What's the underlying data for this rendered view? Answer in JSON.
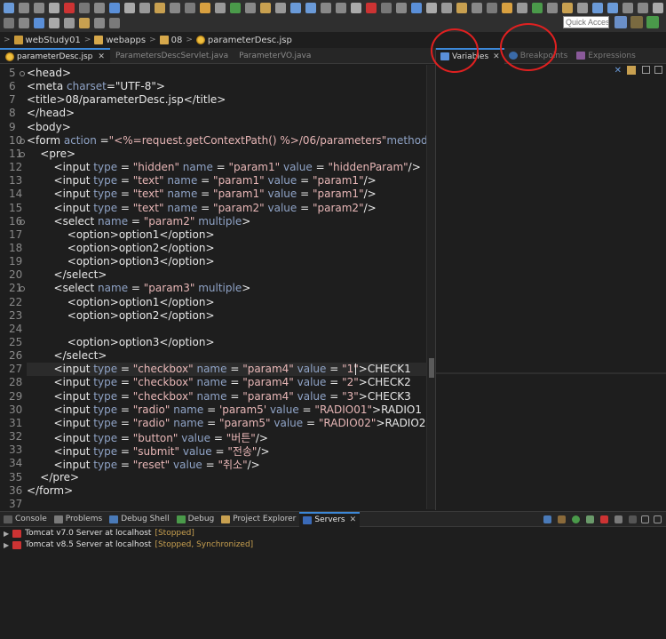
{
  "toolbar": {
    "quick_access_placeholder": "Quick Access"
  },
  "breadcrumb": [
    {
      "label": "webStudy01",
      "icon": "project-icon"
    },
    {
      "label": "webapps",
      "icon": "folder-icon"
    },
    {
      "label": "08",
      "icon": "folder-icon"
    },
    {
      "label": "parameterDesc.jsp",
      "icon": "jsp-file-icon"
    }
  ],
  "editor_tabs": [
    {
      "label": "parameterDesc.jsp",
      "active": true
    },
    {
      "label": "ParametersDescServlet.java",
      "active": false
    },
    {
      "label": "ParameterVO.java",
      "active": false
    }
  ],
  "right_tabs": [
    {
      "label": "Variables",
      "active": true
    },
    {
      "label": "Breakpoints",
      "active": false
    },
    {
      "label": "Expressions",
      "active": false
    }
  ],
  "code": {
    "highlight_line": 27,
    "lines": [
      {
        "n": "5",
        "fold": true,
        "tokens": [
          [
            "tag",
            "<head>"
          ]
        ]
      },
      {
        "n": "6",
        "fold": false,
        "tokens": [
          [
            "tag",
            "<meta "
          ],
          [
            "at",
            "charset"
          ],
          [
            "tag",
            "=\"UTF-8\">"
          ]
        ]
      },
      {
        "n": "7",
        "fold": false,
        "tokens": [
          [
            "tag",
            "<title>08/parameterDesc.jsp</title>"
          ]
        ]
      },
      {
        "n": "8",
        "fold": false,
        "tokens": [
          [
            "tag",
            "</head>"
          ]
        ]
      },
      {
        "n": "9",
        "fold": false,
        "tokens": [
          [
            "tag",
            "<body>"
          ]
        ]
      },
      {
        "n": "10",
        "fold": true,
        "tokens": [
          [
            "tag",
            "<form "
          ],
          [
            "at",
            "action"
          ],
          [
            "tag",
            " ="
          ],
          [
            "str",
            "\"<%=request.getContextPath() %>/06/parameters\""
          ],
          [
            "at",
            "method"
          ],
          [
            "tag",
            " = "
          ],
          [
            "str",
            "\"ge"
          ]
        ]
      },
      {
        "n": "11",
        "fold": true,
        "tokens": [
          [
            "tag",
            "    <pre>"
          ]
        ]
      },
      {
        "n": "12",
        "fold": false,
        "tokens": [
          [
            "tag",
            "        <input "
          ],
          [
            "at",
            "type"
          ],
          [
            "tag",
            " = "
          ],
          [
            "str",
            "\"hidden\""
          ],
          [
            "tag",
            " "
          ],
          [
            "at",
            "name"
          ],
          [
            "tag",
            " = "
          ],
          [
            "str",
            "\"param1\""
          ],
          [
            "tag",
            " "
          ],
          [
            "at",
            "value"
          ],
          [
            "tag",
            " = "
          ],
          [
            "str",
            "\"hiddenParam\""
          ],
          [
            "tag",
            "/>"
          ]
        ]
      },
      {
        "n": "13",
        "fold": false,
        "tokens": [
          [
            "tag",
            "        <input "
          ],
          [
            "at",
            "type"
          ],
          [
            "tag",
            " = "
          ],
          [
            "str",
            "\"text\""
          ],
          [
            "tag",
            " "
          ],
          [
            "at",
            "name"
          ],
          [
            "tag",
            " = "
          ],
          [
            "str",
            "\"param1\""
          ],
          [
            "tag",
            " "
          ],
          [
            "at",
            "value"
          ],
          [
            "tag",
            " = "
          ],
          [
            "str",
            "\"param1\""
          ],
          [
            "tag",
            "/>"
          ]
        ]
      },
      {
        "n": "14",
        "fold": false,
        "tokens": [
          [
            "tag",
            "        <input "
          ],
          [
            "at",
            "type"
          ],
          [
            "tag",
            " = "
          ],
          [
            "str",
            "\"text\""
          ],
          [
            "tag",
            " "
          ],
          [
            "at",
            "name"
          ],
          [
            "tag",
            " = "
          ],
          [
            "str",
            "\"param1\""
          ],
          [
            "tag",
            " "
          ],
          [
            "at",
            "value"
          ],
          [
            "tag",
            " = "
          ],
          [
            "str",
            "\"param1\""
          ],
          [
            "tag",
            "/>"
          ]
        ]
      },
      {
        "n": "15",
        "fold": false,
        "tokens": [
          [
            "tag",
            "        <input "
          ],
          [
            "at",
            "type"
          ],
          [
            "tag",
            " = "
          ],
          [
            "str",
            "\"text\""
          ],
          [
            "tag",
            " "
          ],
          [
            "at",
            "name"
          ],
          [
            "tag",
            " = "
          ],
          [
            "str",
            "\"param2\""
          ],
          [
            "tag",
            " "
          ],
          [
            "at",
            "value"
          ],
          [
            "tag",
            " = "
          ],
          [
            "str",
            "\"param2\""
          ],
          [
            "tag",
            "/>"
          ]
        ]
      },
      {
        "n": "16",
        "fold": true,
        "tokens": [
          [
            "tag",
            "        <select "
          ],
          [
            "at",
            "name"
          ],
          [
            "tag",
            " = "
          ],
          [
            "str",
            "\"param2\""
          ],
          [
            "tag",
            " "
          ],
          [
            "at",
            "multiple"
          ],
          [
            "tag",
            ">"
          ]
        ]
      },
      {
        "n": "17",
        "fold": false,
        "tokens": [
          [
            "tag",
            "            <option>option1</option>"
          ]
        ]
      },
      {
        "n": "18",
        "fold": false,
        "tokens": [
          [
            "tag",
            "            <option>option2</option>"
          ]
        ]
      },
      {
        "n": "19",
        "fold": false,
        "tokens": [
          [
            "tag",
            "            <option>option3</option>"
          ]
        ]
      },
      {
        "n": "20",
        "fold": false,
        "tokens": [
          [
            "tag",
            "        </select>"
          ]
        ]
      },
      {
        "n": "21",
        "fold": true,
        "tokens": [
          [
            "tag",
            "        <select "
          ],
          [
            "at",
            "name"
          ],
          [
            "tag",
            " = "
          ],
          [
            "str",
            "\"param3\""
          ],
          [
            "tag",
            " "
          ],
          [
            "at",
            "multiple"
          ],
          [
            "tag",
            ">"
          ]
        ]
      },
      {
        "n": "22",
        "fold": false,
        "tokens": [
          [
            "tag",
            "            <option>option1</option>"
          ]
        ]
      },
      {
        "n": "23",
        "fold": false,
        "tokens": [
          [
            "tag",
            "            <option>option2</option>"
          ]
        ]
      },
      {
        "n": "24",
        "fold": false,
        "tokens": []
      },
      {
        "n": "25",
        "fold": false,
        "tokens": [
          [
            "tag",
            "            <option>option3</option>"
          ]
        ]
      },
      {
        "n": "26",
        "fold": false,
        "tokens": [
          [
            "tag",
            "        </select>"
          ]
        ]
      },
      {
        "n": "27",
        "fold": false,
        "tokens": [
          [
            "tag",
            "        <input "
          ],
          [
            "at",
            "type"
          ],
          [
            "tag",
            " = "
          ],
          [
            "str",
            "\"checkbox\""
          ],
          [
            "tag",
            " "
          ],
          [
            "at",
            "name"
          ],
          [
            "tag",
            " = "
          ],
          [
            "str",
            "\"param4\""
          ],
          [
            "tag",
            " "
          ],
          [
            "at",
            "value"
          ],
          [
            "tag",
            " = "
          ],
          [
            "str",
            "\"1\""
          ],
          [
            "tag",
            ">CHECK1"
          ]
        ]
      },
      {
        "n": "28",
        "fold": false,
        "tokens": [
          [
            "tag",
            "        <input "
          ],
          [
            "at",
            "type"
          ],
          [
            "tag",
            " = "
          ],
          [
            "str",
            "\"checkbox\""
          ],
          [
            "tag",
            " "
          ],
          [
            "at",
            "name"
          ],
          [
            "tag",
            " = "
          ],
          [
            "str",
            "\"param4\""
          ],
          [
            "tag",
            " "
          ],
          [
            "at",
            "value"
          ],
          [
            "tag",
            " = "
          ],
          [
            "str",
            "\"2\""
          ],
          [
            "tag",
            ">CHECK2"
          ]
        ]
      },
      {
        "n": "29",
        "fold": false,
        "tokens": [
          [
            "tag",
            "        <input "
          ],
          [
            "at",
            "type"
          ],
          [
            "tag",
            " = "
          ],
          [
            "str",
            "\"checkbox\""
          ],
          [
            "tag",
            " "
          ],
          [
            "at",
            "name"
          ],
          [
            "tag",
            " = "
          ],
          [
            "str",
            "\"param4\""
          ],
          [
            "tag",
            " "
          ],
          [
            "at",
            "value"
          ],
          [
            "tag",
            " = "
          ],
          [
            "str",
            "\"3\""
          ],
          [
            "tag",
            ">CHECK3"
          ]
        ]
      },
      {
        "n": "30",
        "fold": false,
        "tokens": [
          [
            "tag",
            "        <input "
          ],
          [
            "at",
            "type"
          ],
          [
            "tag",
            " = "
          ],
          [
            "str",
            "\"radio\""
          ],
          [
            "tag",
            " "
          ],
          [
            "at",
            "name"
          ],
          [
            "tag",
            " = "
          ],
          [
            "str",
            "'param5'"
          ],
          [
            "tag",
            " "
          ],
          [
            "at",
            "value"
          ],
          [
            "tag",
            " = "
          ],
          [
            "str",
            "\"RADIO01\""
          ],
          [
            "tag",
            ">RADIO1"
          ]
        ]
      },
      {
        "n": "31",
        "fold": false,
        "tokens": [
          [
            "tag",
            "        <input "
          ],
          [
            "at",
            "type"
          ],
          [
            "tag",
            " = "
          ],
          [
            "str",
            "\"radio\""
          ],
          [
            "tag",
            " "
          ],
          [
            "at",
            "name"
          ],
          [
            "tag",
            " = "
          ],
          [
            "str",
            "\"param5\""
          ],
          [
            "tag",
            " "
          ],
          [
            "at",
            "value"
          ],
          [
            "tag",
            " = "
          ],
          [
            "str",
            "\"RADIO02\""
          ],
          [
            "tag",
            ">RADIO2"
          ]
        ]
      },
      {
        "n": "32",
        "fold": false,
        "tokens": [
          [
            "tag",
            "        <input "
          ],
          [
            "at",
            "type"
          ],
          [
            "tag",
            " = "
          ],
          [
            "str",
            "\"button\""
          ],
          [
            "tag",
            " "
          ],
          [
            "at",
            "value"
          ],
          [
            "tag",
            " = "
          ],
          [
            "str",
            "\"버튼\""
          ],
          [
            "tag",
            "/>"
          ]
        ]
      },
      {
        "n": "33",
        "fold": false,
        "tokens": [
          [
            "tag",
            "        <input "
          ],
          [
            "at",
            "type"
          ],
          [
            "tag",
            " = "
          ],
          [
            "str",
            "\"submit\""
          ],
          [
            "tag",
            " "
          ],
          [
            "at",
            "value"
          ],
          [
            "tag",
            " = "
          ],
          [
            "str",
            "\"전송\""
          ],
          [
            "tag",
            "/>"
          ]
        ]
      },
      {
        "n": "34",
        "fold": false,
        "tokens": [
          [
            "tag",
            "        <input "
          ],
          [
            "at",
            "type"
          ],
          [
            "tag",
            " = "
          ],
          [
            "str",
            "\"reset\""
          ],
          [
            "tag",
            " "
          ],
          [
            "at",
            "value"
          ],
          [
            "tag",
            " = "
          ],
          [
            "str",
            "\"취소\""
          ],
          [
            "tag",
            "/>"
          ]
        ]
      },
      {
        "n": "35",
        "fold": false,
        "tokens": [
          [
            "tag",
            "    </pre>"
          ]
        ]
      },
      {
        "n": "36",
        "fold": false,
        "tokens": [
          [
            "tag",
            "</form>"
          ]
        ]
      },
      {
        "n": "37",
        "fold": false,
        "tokens": []
      }
    ]
  },
  "bottom_tabs": [
    {
      "label": "Console",
      "active": false
    },
    {
      "label": "Problems",
      "active": false
    },
    {
      "label": "Debug Shell",
      "active": false
    },
    {
      "label": "Debug",
      "active": false
    },
    {
      "label": "Project Explorer",
      "active": false
    },
    {
      "label": "Servers",
      "active": true
    }
  ],
  "servers": [
    {
      "name": "Tomcat v7.0 Server at localhost",
      "status": "[Stopped]"
    },
    {
      "name": "Tomcat v8.5 Server at localhost",
      "status": "[Stopped, Synchronized]"
    }
  ],
  "colors": {
    "annotation_circle": "#e02020",
    "active_tab_accent": "#3c88d8"
  }
}
